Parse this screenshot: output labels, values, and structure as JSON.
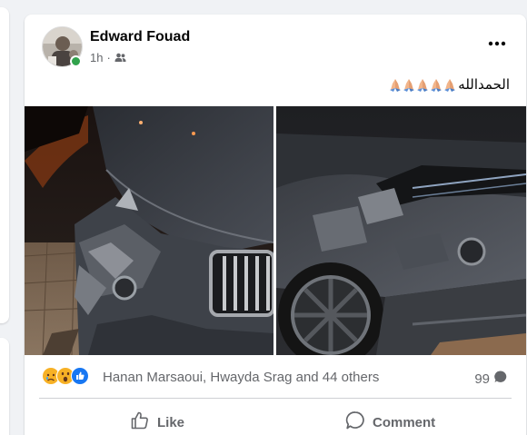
{
  "post": {
    "author": "Edward Fouad",
    "time": "1h",
    "separator": "·",
    "audience_icon": "friends-icon",
    "caption_text": "الحمدالله",
    "caption_emoji": "folded-hands-icon",
    "caption_emoji_count": 5
  },
  "photos": [
    {
      "name": "car-damage-photo-1",
      "description_icon": "photo"
    },
    {
      "name": "car-damage-photo-2",
      "description_icon": "photo"
    }
  ],
  "reactions": {
    "icons": [
      "sad-reaction-icon",
      "wow-reaction-icon",
      "like-reaction-icon"
    ],
    "reactors_text": "Hanan Marsaoui, Hwayda Srag and 44 others",
    "comment_count": "99"
  },
  "actions": {
    "like_label": "Like",
    "comment_label": "Comment"
  },
  "colors": {
    "accent": "#1877f2",
    "online": "#31a24c",
    "secondary_text": "#65676b"
  }
}
